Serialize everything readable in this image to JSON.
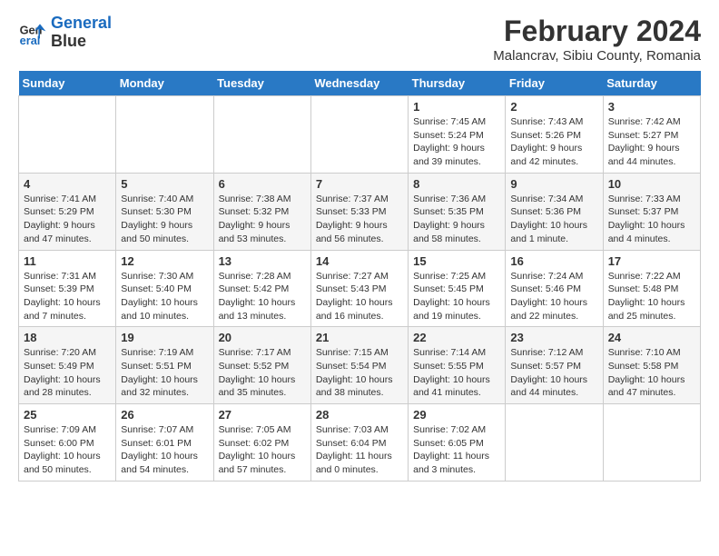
{
  "header": {
    "logo_line1": "General",
    "logo_line2": "Blue",
    "title": "February 2024",
    "subtitle": "Malancrav, Sibiu County, Romania"
  },
  "weekdays": [
    "Sunday",
    "Monday",
    "Tuesday",
    "Wednesday",
    "Thursday",
    "Friday",
    "Saturday"
  ],
  "weeks": [
    [
      {
        "day": "",
        "info": ""
      },
      {
        "day": "",
        "info": ""
      },
      {
        "day": "",
        "info": ""
      },
      {
        "day": "",
        "info": ""
      },
      {
        "day": "1",
        "info": "Sunrise: 7:45 AM\nSunset: 5:24 PM\nDaylight: 9 hours\nand 39 minutes."
      },
      {
        "day": "2",
        "info": "Sunrise: 7:43 AM\nSunset: 5:26 PM\nDaylight: 9 hours\nand 42 minutes."
      },
      {
        "day": "3",
        "info": "Sunrise: 7:42 AM\nSunset: 5:27 PM\nDaylight: 9 hours\nand 44 minutes."
      }
    ],
    [
      {
        "day": "4",
        "info": "Sunrise: 7:41 AM\nSunset: 5:29 PM\nDaylight: 9 hours\nand 47 minutes."
      },
      {
        "day": "5",
        "info": "Sunrise: 7:40 AM\nSunset: 5:30 PM\nDaylight: 9 hours\nand 50 minutes."
      },
      {
        "day": "6",
        "info": "Sunrise: 7:38 AM\nSunset: 5:32 PM\nDaylight: 9 hours\nand 53 minutes."
      },
      {
        "day": "7",
        "info": "Sunrise: 7:37 AM\nSunset: 5:33 PM\nDaylight: 9 hours\nand 56 minutes."
      },
      {
        "day": "8",
        "info": "Sunrise: 7:36 AM\nSunset: 5:35 PM\nDaylight: 9 hours\nand 58 minutes."
      },
      {
        "day": "9",
        "info": "Sunrise: 7:34 AM\nSunset: 5:36 PM\nDaylight: 10 hours\nand 1 minute."
      },
      {
        "day": "10",
        "info": "Sunrise: 7:33 AM\nSunset: 5:37 PM\nDaylight: 10 hours\nand 4 minutes."
      }
    ],
    [
      {
        "day": "11",
        "info": "Sunrise: 7:31 AM\nSunset: 5:39 PM\nDaylight: 10 hours\nand 7 minutes."
      },
      {
        "day": "12",
        "info": "Sunrise: 7:30 AM\nSunset: 5:40 PM\nDaylight: 10 hours\nand 10 minutes."
      },
      {
        "day": "13",
        "info": "Sunrise: 7:28 AM\nSunset: 5:42 PM\nDaylight: 10 hours\nand 13 minutes."
      },
      {
        "day": "14",
        "info": "Sunrise: 7:27 AM\nSunset: 5:43 PM\nDaylight: 10 hours\nand 16 minutes."
      },
      {
        "day": "15",
        "info": "Sunrise: 7:25 AM\nSunset: 5:45 PM\nDaylight: 10 hours\nand 19 minutes."
      },
      {
        "day": "16",
        "info": "Sunrise: 7:24 AM\nSunset: 5:46 PM\nDaylight: 10 hours\nand 22 minutes."
      },
      {
        "day": "17",
        "info": "Sunrise: 7:22 AM\nSunset: 5:48 PM\nDaylight: 10 hours\nand 25 minutes."
      }
    ],
    [
      {
        "day": "18",
        "info": "Sunrise: 7:20 AM\nSunset: 5:49 PM\nDaylight: 10 hours\nand 28 minutes."
      },
      {
        "day": "19",
        "info": "Sunrise: 7:19 AM\nSunset: 5:51 PM\nDaylight: 10 hours\nand 32 minutes."
      },
      {
        "day": "20",
        "info": "Sunrise: 7:17 AM\nSunset: 5:52 PM\nDaylight: 10 hours\nand 35 minutes."
      },
      {
        "day": "21",
        "info": "Sunrise: 7:15 AM\nSunset: 5:54 PM\nDaylight: 10 hours\nand 38 minutes."
      },
      {
        "day": "22",
        "info": "Sunrise: 7:14 AM\nSunset: 5:55 PM\nDaylight: 10 hours\nand 41 minutes."
      },
      {
        "day": "23",
        "info": "Sunrise: 7:12 AM\nSunset: 5:57 PM\nDaylight: 10 hours\nand 44 minutes."
      },
      {
        "day": "24",
        "info": "Sunrise: 7:10 AM\nSunset: 5:58 PM\nDaylight: 10 hours\nand 47 minutes."
      }
    ],
    [
      {
        "day": "25",
        "info": "Sunrise: 7:09 AM\nSunset: 6:00 PM\nDaylight: 10 hours\nand 50 minutes."
      },
      {
        "day": "26",
        "info": "Sunrise: 7:07 AM\nSunset: 6:01 PM\nDaylight: 10 hours\nand 54 minutes."
      },
      {
        "day": "27",
        "info": "Sunrise: 7:05 AM\nSunset: 6:02 PM\nDaylight: 10 hours\nand 57 minutes."
      },
      {
        "day": "28",
        "info": "Sunrise: 7:03 AM\nSunset: 6:04 PM\nDaylight: 11 hours\nand 0 minutes."
      },
      {
        "day": "29",
        "info": "Sunrise: 7:02 AM\nSunset: 6:05 PM\nDaylight: 11 hours\nand 3 minutes."
      },
      {
        "day": "",
        "info": ""
      },
      {
        "day": "",
        "info": ""
      }
    ]
  ]
}
